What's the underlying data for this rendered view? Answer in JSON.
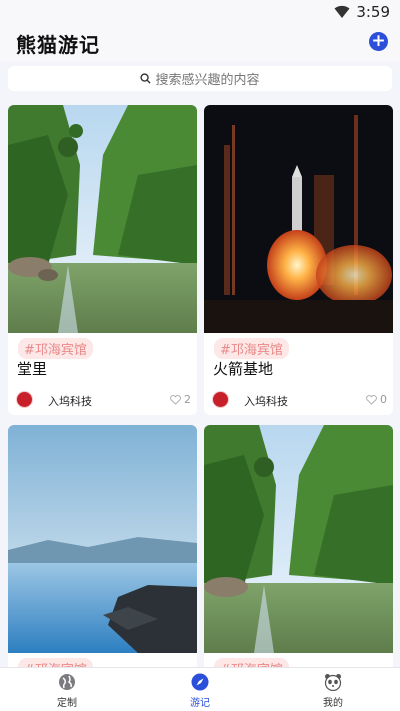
{
  "status_bar": {
    "time": "3:59",
    "icons": [
      "wifi-icon",
      "signal-icon"
    ]
  },
  "header": {
    "title": "熊猫游记",
    "add_icon": "plus-circle-icon",
    "add_label": "+"
  },
  "search": {
    "placeholder": "搜索感兴趣的内容",
    "icon": "search-icon"
  },
  "cards": [
    {
      "tag": "#邛海宾馆",
      "title": "堂里",
      "author": "入坞科技",
      "likes": "2",
      "image": "lake-mountain-photo"
    },
    {
      "tag": "#邛海宾馆",
      "title": "火箭基地",
      "author": "入坞科技",
      "likes": "0",
      "image": "rocket-launch-photo"
    },
    {
      "tag": "#邛海宾馆",
      "title": "",
      "author": "",
      "likes": "",
      "image": "blue-lake-photo"
    },
    {
      "tag": "#邛海宾馆",
      "title": "",
      "author": "",
      "likes": "",
      "image": "lake-mountain-photo"
    }
  ],
  "tabs": [
    {
      "label": "定制",
      "icon": "globe-icon",
      "active": false
    },
    {
      "label": "游记",
      "icon": "compass-icon",
      "active": true
    },
    {
      "label": "我的",
      "icon": "panda-icon",
      "active": false
    }
  ],
  "colors": {
    "accent": "#2b4fd8",
    "tag_bg": "#fde7e7",
    "tag_text": "#e98a8a",
    "background": "#f4f5fa"
  }
}
